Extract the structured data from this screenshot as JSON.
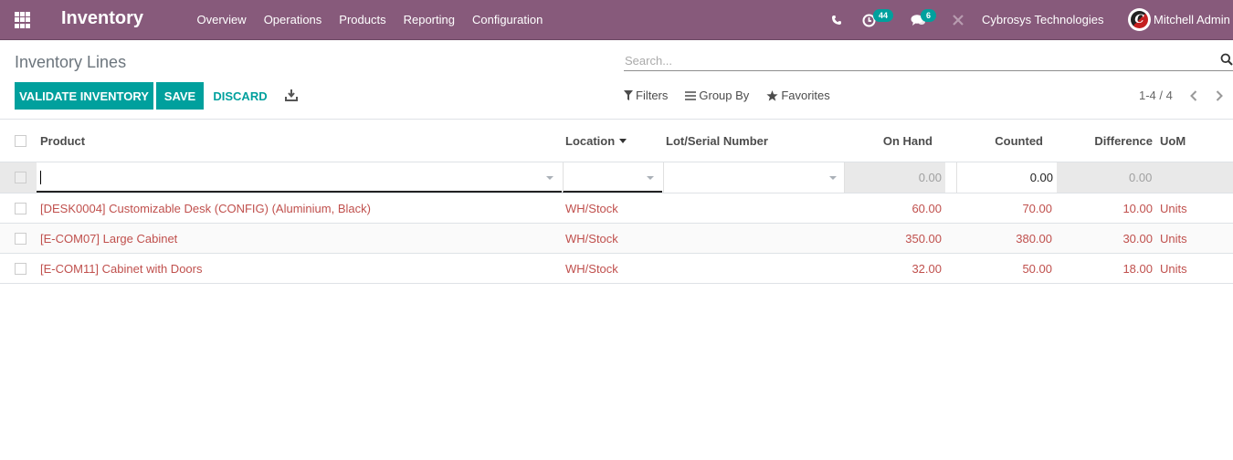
{
  "navbar": {
    "app_name": "Inventory",
    "menu": [
      "Overview",
      "Operations",
      "Products",
      "Reporting",
      "Configuration"
    ],
    "activity_count": "44",
    "messages_count": "6",
    "company": "Cybrosys Technologies",
    "user": "Mitchell Admin",
    "avatar_letter": "C",
    "accent_color": "#875a7b"
  },
  "control_panel": {
    "breadcrumb": "Inventory Lines",
    "search_placeholder": "Search...",
    "buttons": {
      "validate": "VALIDATE INVENTORY",
      "save": "SAVE",
      "discard": "DISCARD"
    },
    "filters_label": "Filters",
    "group_by_label": "Group By",
    "favorites_label": "Favorites",
    "pager": "1-4 / 4",
    "button_color": "#00a09d"
  },
  "table": {
    "columns": {
      "product": "Product",
      "location": "Location",
      "lot": "Lot/Serial Number",
      "on_hand": "On Hand",
      "counted": "Counted",
      "difference": "Difference",
      "uom": "UoM"
    },
    "edit_row": {
      "product": "",
      "location": "",
      "lot": "",
      "on_hand": "0.00",
      "counted": "0.00",
      "difference": "0.00"
    },
    "rows": [
      {
        "product": "[DESK0004] Customizable Desk (CONFIG) (Aluminium, Black)",
        "location": "WH/Stock",
        "lot": "",
        "on_hand": "60.00",
        "counted": "70.00",
        "difference": "10.00",
        "uom": "Units"
      },
      {
        "product": "[E-COM07] Large Cabinet",
        "location": "WH/Stock",
        "lot": "",
        "on_hand": "350.00",
        "counted": "380.00",
        "difference": "30.00",
        "uom": "Units"
      },
      {
        "product": "[E-COM11] Cabinet with Doors",
        "location": "WH/Stock",
        "lot": "",
        "on_hand": "32.00",
        "counted": "50.00",
        "difference": "18.00",
        "uom": "Units"
      }
    ],
    "row_text_color": "#c0504d"
  }
}
